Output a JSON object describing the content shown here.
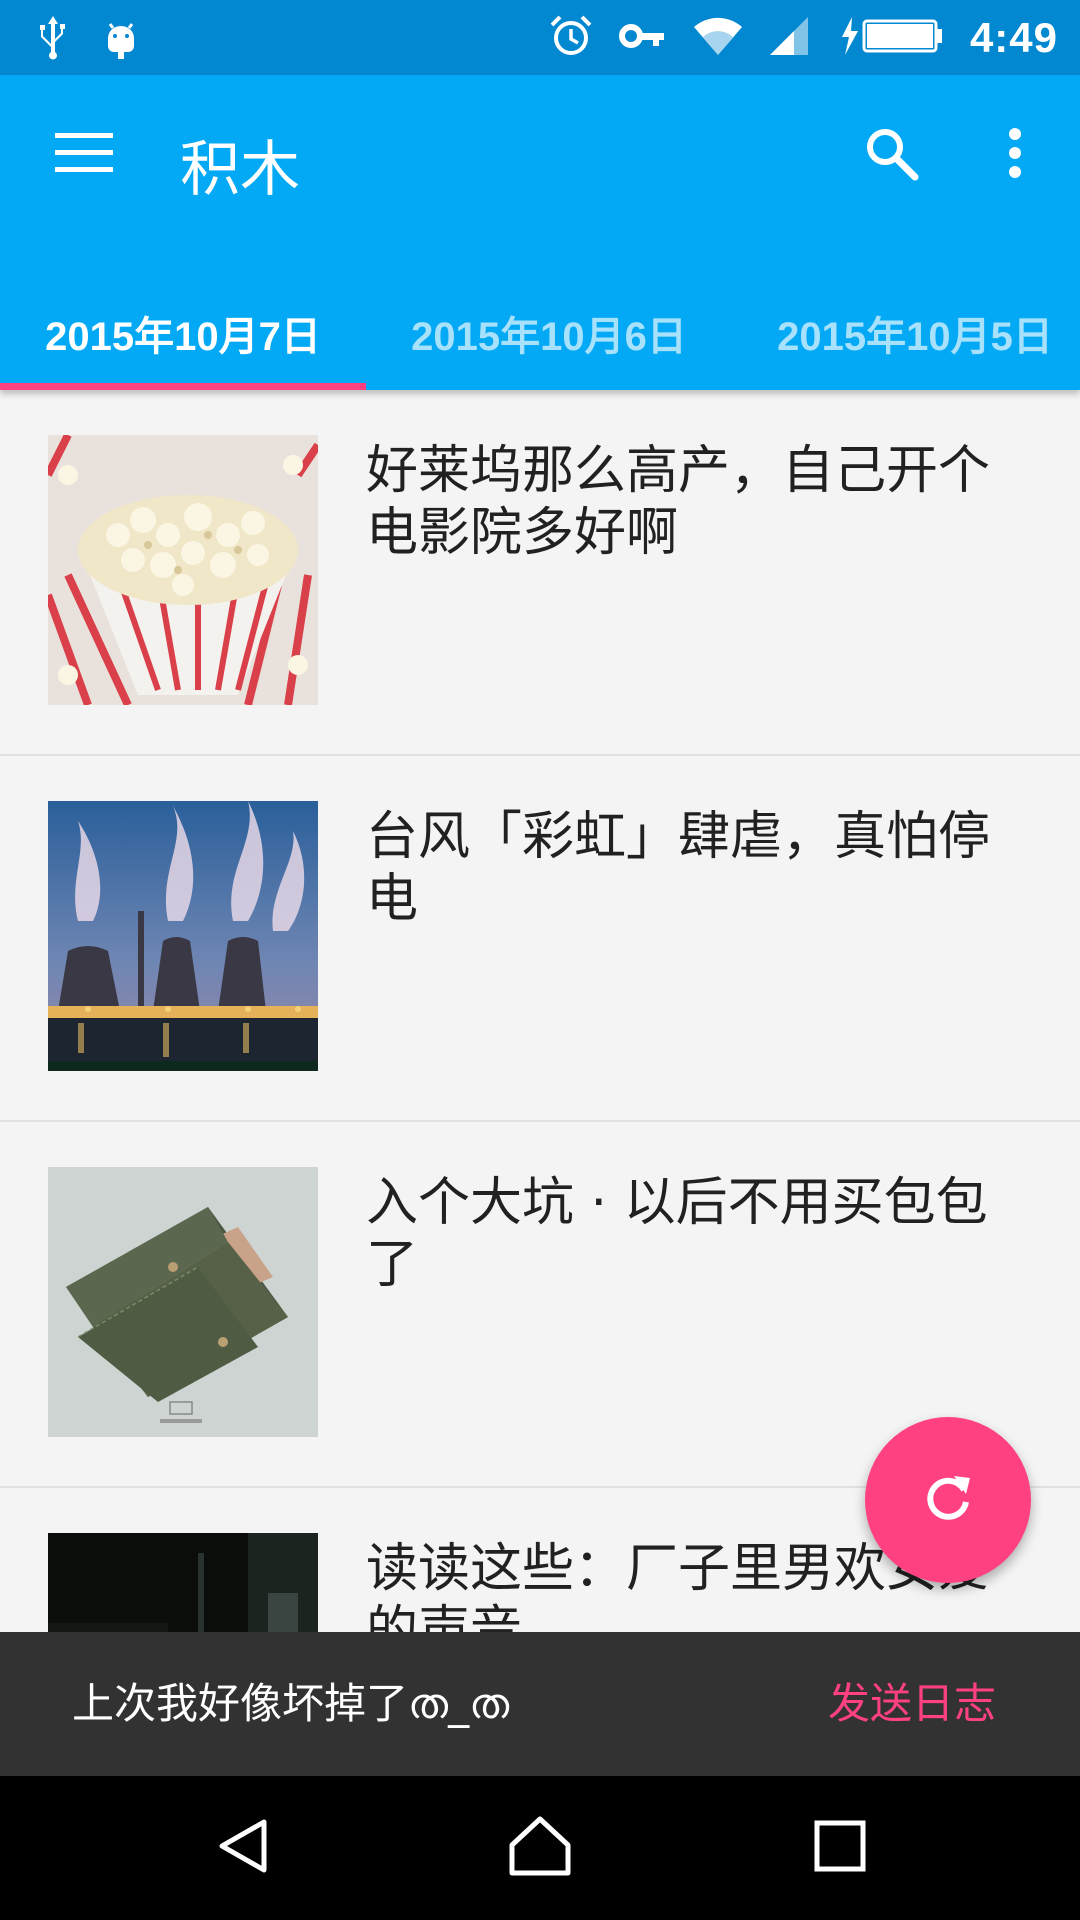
{
  "status_bar": {
    "time": "4:49",
    "left_icons": [
      "usb-icon",
      "android-debug-icon"
    ],
    "right_icons": [
      "alarm-icon",
      "vpn-key-icon",
      "wifi-icon",
      "signal-icon",
      "battery-charging-icon"
    ]
  },
  "app_bar": {
    "title": "积木",
    "menu_icon": "hamburger-menu-icon",
    "search_icon": "search-icon",
    "more_icon": "more-vertical-icon",
    "color": "#03a9f4"
  },
  "tabs": [
    {
      "label": "2015年10月7日",
      "selected": true
    },
    {
      "label": "2015年10月6日",
      "selected": false
    },
    {
      "label": "2015年10月5日",
      "selected": false
    }
  ],
  "list": {
    "items": [
      {
        "title": "好莱坞那么高产，自己开个电影院多好啊",
        "image": "popcorn"
      },
      {
        "title": "台风「彩虹」肆虐，真怕停电",
        "image": "cooling-towers"
      },
      {
        "title": "入个大坑 · 以后不用买包包了",
        "image": "wallet"
      },
      {
        "title": "读读这些：厂子里男欢女爱的声音",
        "image": "dark-street"
      }
    ]
  },
  "fab": {
    "icon": "refresh-icon",
    "color": "#ff4081"
  },
  "snackbar": {
    "message": "上次我好像坏掉了ത_ത",
    "action": "发送日志",
    "action_color": "#ff4081"
  },
  "nav_bar": {
    "icons": [
      "back-icon",
      "home-icon",
      "recents-icon"
    ]
  }
}
